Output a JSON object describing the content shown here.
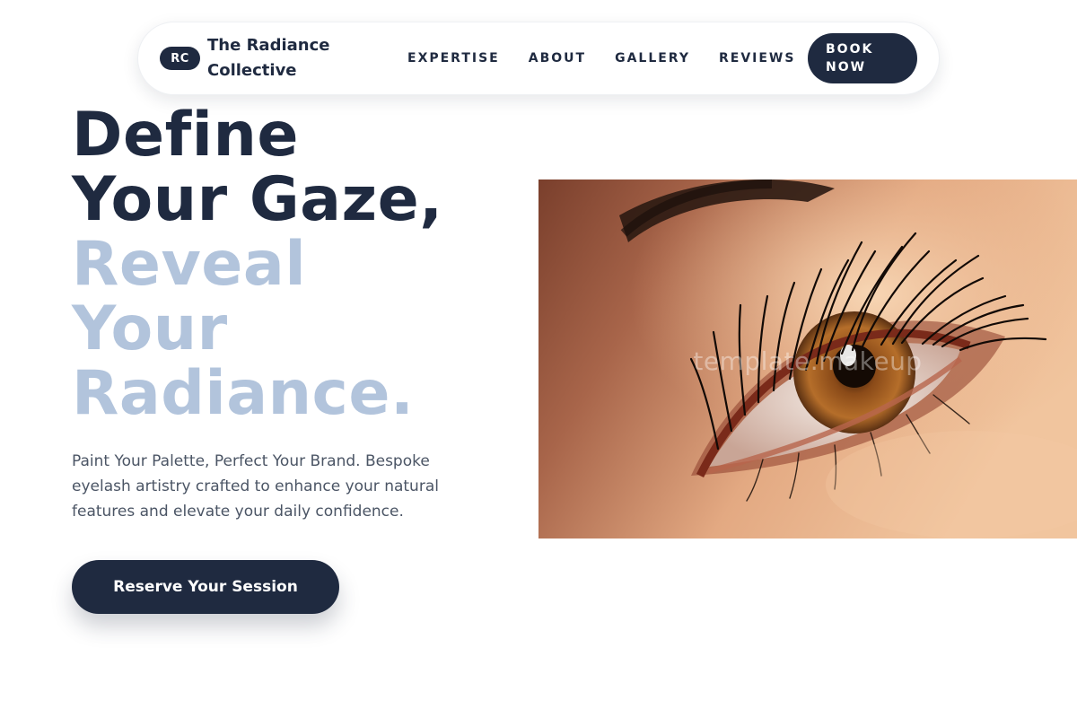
{
  "nav": {
    "badge": "RC",
    "brand_line1": "The Radiance",
    "brand_line2": "Collective",
    "links": [
      "EXPERTISE",
      "ABOUT",
      "GALLERY",
      "REVIEWS"
    ],
    "book_line1": "BOOK",
    "book_line2": "NOW"
  },
  "hero": {
    "title_dark": [
      "Define",
      "Your Gaze,"
    ],
    "title_light": [
      "Reveal",
      "Your",
      "Radiance."
    ],
    "subtitle": "Paint Your Palette, Perfect Your Brand. Bespoke eyelash artistry crafted to enhance your natural features and elevate your daily confidence.",
    "cta": "Reserve Your Session",
    "image_watermark": "template.makeup"
  },
  "colors": {
    "primary": "#1f2a40",
    "accent_light": "#b2c4dc",
    "body_text": "#4b5565"
  }
}
